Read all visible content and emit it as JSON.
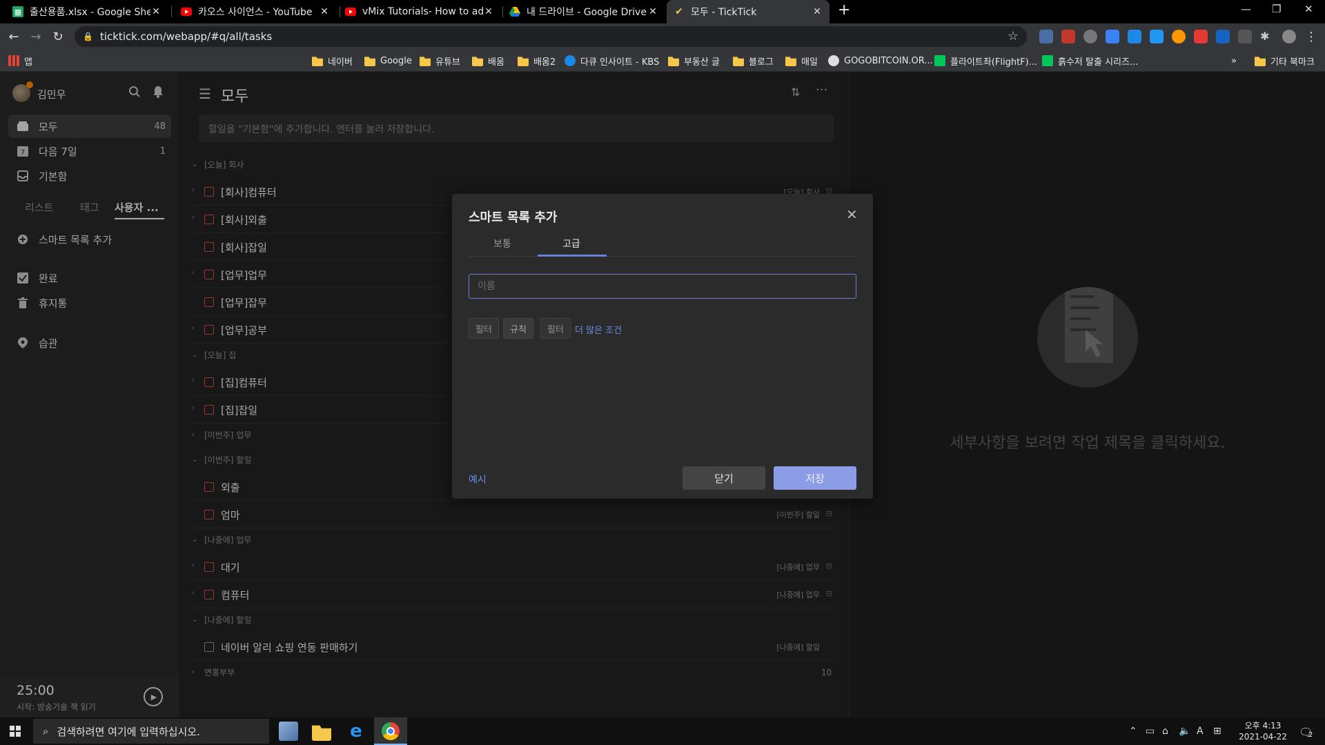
{
  "browser": {
    "tabs": [
      {
        "title": "출산용품.xlsx - Google Sheets",
        "icon": "sheets-icon",
        "color": "#1fa463"
      },
      {
        "title": "카오스 사이언스 - YouTube",
        "icon": "youtube-icon",
        "color": "#ff0000"
      },
      {
        "title": "vMix Tutorials- How to add vMi",
        "icon": "youtube-icon",
        "color": "#ff0000"
      },
      {
        "title": "내 드라이브 - Google Drive",
        "icon": "drive-icon",
        "color": "#fbbc04"
      },
      {
        "title": "모두 - TickTick",
        "icon": "ticktick-icon",
        "color": "#4772fa"
      }
    ],
    "url": "ticktick.com/webapp/#q/all/tasks",
    "bookmarks": [
      "앱",
      "네이버",
      "Google",
      "유튜브",
      "배움",
      "배움2",
      "다큐 인사이트 - KBS",
      "부동산 글",
      "블로그",
      "매일",
      "GOGOBITCOIN.OR...",
      "플라이트좌(FlightF)...",
      "흙수저 탈출 시리즈...",
      "기타 북마크"
    ],
    "bookmark_more": "»"
  },
  "sidebar": {
    "user_name": "김민우",
    "nav": [
      {
        "label": "모두",
        "count": "48"
      },
      {
        "label": "다음 7일",
        "count": "1"
      },
      {
        "label": "기본함",
        "count": ""
      }
    ],
    "tabs": [
      "리스트",
      "태그",
      "사용자 ..."
    ],
    "add_smart": "스마트 목록 추가",
    "bottom": [
      "완료",
      "휴지통"
    ],
    "habit": "습관"
  },
  "pomodoro": {
    "time": "25:00",
    "subtitle": "시작: 방송기술 책 읽기"
  },
  "main": {
    "title": "모두",
    "add_placeholder": "할일을 \"기본함\"에 추가합니다. 엔터를 눌러 저장합니다.",
    "groups": [
      {
        "label": "[오늘] 회사",
        "tasks": [
          {
            "title": "[회사]컴퓨터",
            "tag": "[오늘] 회사"
          },
          {
            "title": "[회사]외출",
            "tag": ""
          },
          {
            "title": "[회사]잡일",
            "tag": ""
          },
          {
            "title": "[업무]업무",
            "tag": ""
          },
          {
            "title": "[업무]잡무",
            "tag": ""
          },
          {
            "title": "[업무]공부",
            "tag": ""
          }
        ]
      },
      {
        "label": "[오늘] 집",
        "tasks": [
          {
            "title": "[집]컴퓨터",
            "tag": ""
          },
          {
            "title": "[집]잡일",
            "tag": ""
          }
        ]
      },
      {
        "label": "[이번주] 업무",
        "tasks": []
      },
      {
        "label": "[이번주] 할일",
        "tasks": [
          {
            "title": "외출",
            "tag": ""
          },
          {
            "title": "엄마",
            "tag": "[이번주] 할일"
          }
        ]
      },
      {
        "label": "[나중에] 업무",
        "tasks": [
          {
            "title": "대기",
            "tag": "[나중에] 업무"
          },
          {
            "title": "컴퓨터",
            "tag": "[나중에] 업무"
          }
        ]
      },
      {
        "label": "[나중에] 할일",
        "tasks": [
          {
            "title": "네이버 알리 쇼핑 연동 판매하기",
            "tag": "[나중에] 할일"
          }
        ]
      },
      {
        "label": "면홍부부",
        "count": "10",
        "tasks": []
      }
    ]
  },
  "detail": {
    "empty_message": "세부사항을 보려면 작업 제목을 클릭하세요."
  },
  "modal": {
    "title": "스마트 목록 추가",
    "tabs": [
      "보통",
      "고급"
    ],
    "active_tab": "고급",
    "name_placeholder": "이름",
    "name_value": "",
    "chips": [
      "필터",
      "규칙",
      "필터"
    ],
    "more_conditions": "더 많은 조건",
    "example_link": "예시",
    "close_button": "닫기",
    "save_button": "저장"
  },
  "taskbar": {
    "search_placeholder": "검색하려면 여기에 입력하십시오.",
    "time": "오후 4:13",
    "date": "2021-04-22",
    "notification_count": "2"
  },
  "colors": {
    "accent": "#6b7fd6",
    "save_button": "#8c9ce6",
    "task_checkbox": "#d64545",
    "link": "#6b8ee0"
  }
}
